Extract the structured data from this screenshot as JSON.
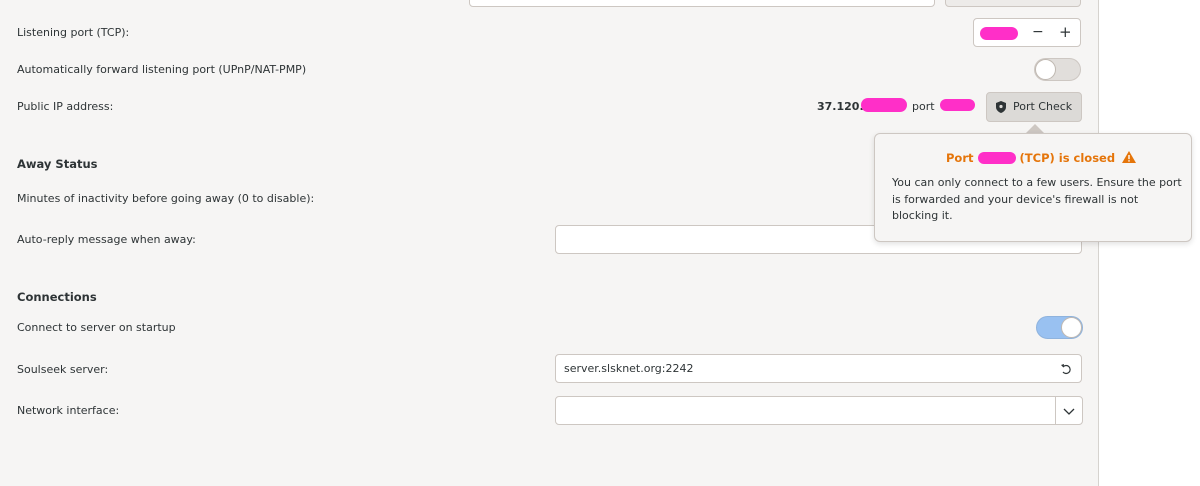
{
  "colors": {
    "accent": "#99c1f1",
    "warning": "#e5750a",
    "redaction": "#ff2fc8",
    "panel": "#f6f5f4"
  },
  "network": {
    "listening_port_label": "Listening port (TCP):",
    "upnp_label": "Automatically forward listening port (UPnP/NAT-PMP)",
    "upnp_enabled": false,
    "public_ip_label": "Public IP address:",
    "public_ip_value": "37.120.",
    "port_word": "port",
    "port_check_label": "Port Check",
    "port_check_icon": "shield-icon",
    "minus_glyph": "−",
    "plus_glyph": "+"
  },
  "popover": {
    "title_prefix": "Port",
    "title_suffix": "(TCP) is closed",
    "warning_icon": "warning-icon",
    "body": "You can only connect to a few users. Ensure the port is forwarded and your device's firewall is not blocking it."
  },
  "away": {
    "heading": "Away Status",
    "inactivity_label": "Minutes of inactivity before going away (0 to disable):",
    "autoreply_label": "Auto-reply message when away:",
    "autoreply_value": ""
  },
  "connections": {
    "heading": "Connections",
    "connect_startup_label": "Connect to server on startup",
    "connect_startup_enabled": true,
    "server_label": "Soulseek server:",
    "server_value": "server.slsknet.org:2242",
    "reset_icon": "reset-icon",
    "interface_label": "Network interface:",
    "interface_value": "",
    "dropdown_icon": "chevron-down-icon"
  }
}
